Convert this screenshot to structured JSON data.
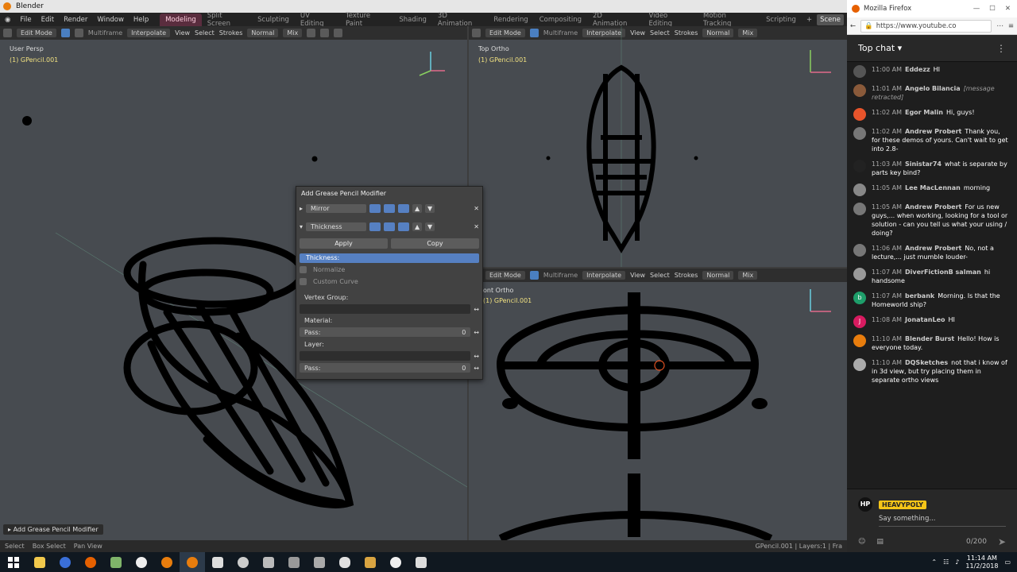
{
  "blender": {
    "title": "Blender",
    "menu": [
      "File",
      "Edit",
      "Render",
      "Window",
      "Help"
    ],
    "workspaces": [
      "Modeling",
      "Split Screen",
      "Sculpting",
      "UV Editing",
      "Texture Paint",
      "Shading",
      "3D Animation",
      "Rendering",
      "Compositing",
      "2D Animation",
      "Video Editing",
      "Motion Tracking",
      "Scripting"
    ],
    "active_workspace": "Modeling",
    "scene_label": "Scene",
    "header": {
      "mode": "Edit Mode",
      "multiframe": "Multiframe",
      "interpolate": "Interpolate",
      "view": "View",
      "select": "Select",
      "strokes": "Strokes",
      "normal": "Normal",
      "mix": "Mix"
    },
    "viewports": {
      "left": {
        "label": "User Persp",
        "object": "(1) GPencil.001"
      },
      "top_right": {
        "label": "Top Ortho",
        "object": "(1) GPencil.001"
      },
      "bottom_right": {
        "label": "ont Ortho",
        "object": "(1) GPencil.001"
      }
    },
    "modifier_panel": {
      "title": "Add Grease Pencil Modifier",
      "mirror_name": "Mirror",
      "thickness_name": "Thickness",
      "apply": "Apply",
      "copy": "Copy",
      "thickness_field": "Thickness:",
      "normalize": "Normalize",
      "custom_curve": "Custom Curve",
      "vertex_group": "Vertex Group:",
      "material": "Material:",
      "pass_label": "Pass:",
      "pass_value": "0",
      "layer": "Layer:",
      "pass2_label": "Pass:",
      "pass2_value": "0"
    },
    "operator_panel": "Add Grease Pencil Modifier",
    "status": {
      "select": "Select",
      "box_select": "Box Select",
      "pan_view": "Pan View",
      "right": "GPencil.001 | Layers:1 | Fra"
    }
  },
  "firefox": {
    "title": "Mozilla Firefox",
    "url": "https://www.youtube.co",
    "chat": {
      "header": "Top chat",
      "messages": [
        {
          "time": "11:00 AM",
          "author": "Eddezz",
          "text": "HI",
          "avatar_color": "#555"
        },
        {
          "time": "11:01 AM",
          "author": "Angelo Bilancia",
          "text": "[message retracted]",
          "retracted": true,
          "avatar_color": "#8a5a3a"
        },
        {
          "time": "11:02 AM",
          "author": "Egor Malin",
          "text": "Hi, guys!",
          "avatar_color": "#e8542b"
        },
        {
          "time": "11:02 AM",
          "author": "Andrew Probert",
          "text": "Thank you, for these demos of yours. Can't wait to get into 2.8-",
          "avatar_color": "#777"
        },
        {
          "time": "11:03 AM",
          "author": "Sinistar74",
          "text": "what is separate by parts key bind?",
          "avatar_color": "#222"
        },
        {
          "time": "11:05 AM",
          "author": "Lee MacLennan",
          "text": "morning",
          "avatar_color": "#888"
        },
        {
          "time": "11:05 AM",
          "author": "Andrew Probert",
          "text": "For us new guys,... when working, looking for a tool or solution - can you tell us what your using / doing?",
          "avatar_color": "#777"
        },
        {
          "time": "11:06 AM",
          "author": "Andrew Probert",
          "text": "No, not a lecture,... just mumble louder-",
          "avatar_color": "#777"
        },
        {
          "time": "11:07 AM",
          "author": "DiverFictionB salman",
          "text": "hi handsome",
          "avatar_color": "#999"
        },
        {
          "time": "11:07 AM",
          "author": "berbank",
          "text": "Morning. Is that the Homeworld ship?",
          "avatar_color": "#1e9e6a",
          "initial": "b"
        },
        {
          "time": "11:08 AM",
          "author": "JonatanLeo",
          "text": "HI",
          "avatar_color": "#d81b60",
          "initial": "J"
        },
        {
          "time": "11:10 AM",
          "author": "Blender Burst",
          "text": "Hello! How is everyone today.",
          "avatar_color": "#e87d0d"
        },
        {
          "time": "11:10 AM",
          "author": "DQSketches",
          "text": "not that i know of in 3d view, but try placing them in separate ortho views",
          "avatar_color": "#aaa"
        }
      ],
      "user_badge": "HP",
      "username": "HEAVYPOLY",
      "placeholder": "Say something...",
      "char_count": "0/200"
    }
  },
  "taskbar": {
    "time": "11:14 AM",
    "date": "11/2/2018"
  }
}
